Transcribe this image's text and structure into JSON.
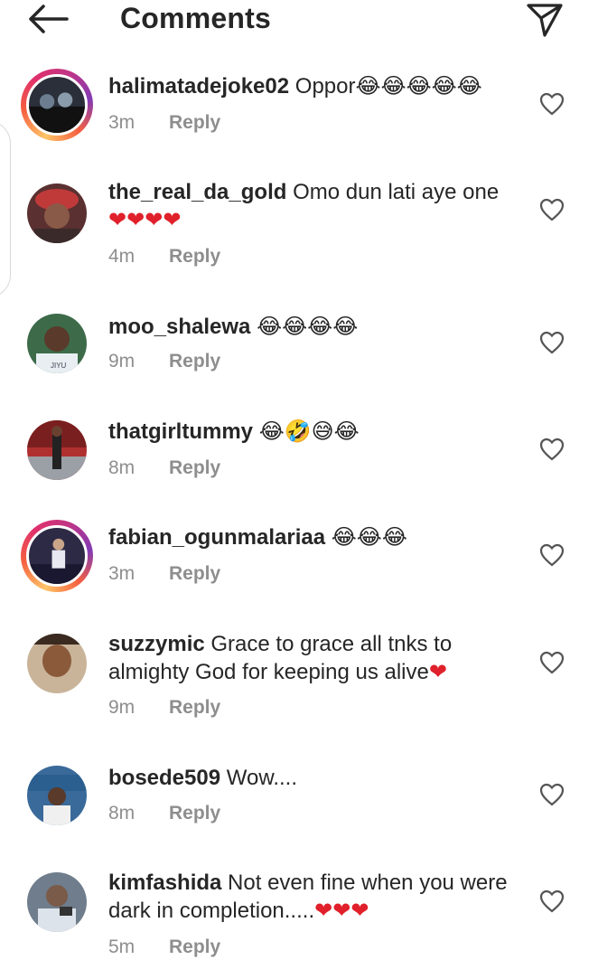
{
  "header": {
    "title": "Comments"
  },
  "comments": [
    {
      "username": "halimatadejoke02",
      "text": " Oppor",
      "emoji": "😂😂😂😂😂",
      "time": "3m",
      "reply": "Reply",
      "avatar_color": "#2a2f3a"
    },
    {
      "username": "the_real_da_gold",
      "text": " Omo dun lati aye one",
      "emoji": "❤❤❤❤",
      "time": "4m",
      "reply": "Reply",
      "avatar_color": "#7a3b3b"
    },
    {
      "username": "moo_shalewa",
      "text": "",
      "emoji": "😂😂😂😂",
      "time": "9m",
      "reply": "Reply",
      "avatar_color": "#3d6b4a"
    },
    {
      "username": "thatgirltummy",
      "text": "",
      "emoji": "😂🤣😅😂",
      "time": "8m",
      "reply": "Reply",
      "avatar_color": "#8a5a4a"
    },
    {
      "username": "fabian_ogunmalariaa",
      "text": "",
      "emoji": "😂😂😂",
      "time": "3m",
      "reply": "Reply",
      "avatar_color": "#2d2a45"
    },
    {
      "username": "suzzymic",
      "text": " Grace to grace all tnks to almighty God for keeping us alive",
      "emoji": "❤",
      "time": "9m",
      "reply": "Reply",
      "avatar_color": "#9b6a4a"
    },
    {
      "username": "bosede509",
      "text": " Wow....",
      "emoji": "",
      "time": "8m",
      "reply": "Reply",
      "avatar_color": "#3a6a9a"
    },
    {
      "username": "kimfashida",
      "text": " Not even  fine when you were dark in completion.....",
      "emoji": "❤❤❤",
      "time": "5m",
      "reply": "Reply",
      "avatar_color": "#6f7d8c"
    }
  ],
  "colors": {
    "text": "#262626",
    "meta": "#8e8e8e",
    "heart_red": "#e0202a",
    "story_ring": "#e1306c"
  },
  "icons": {
    "back": "back-arrow-icon",
    "send": "direct-send-icon",
    "like": "heart-outline-icon"
  }
}
